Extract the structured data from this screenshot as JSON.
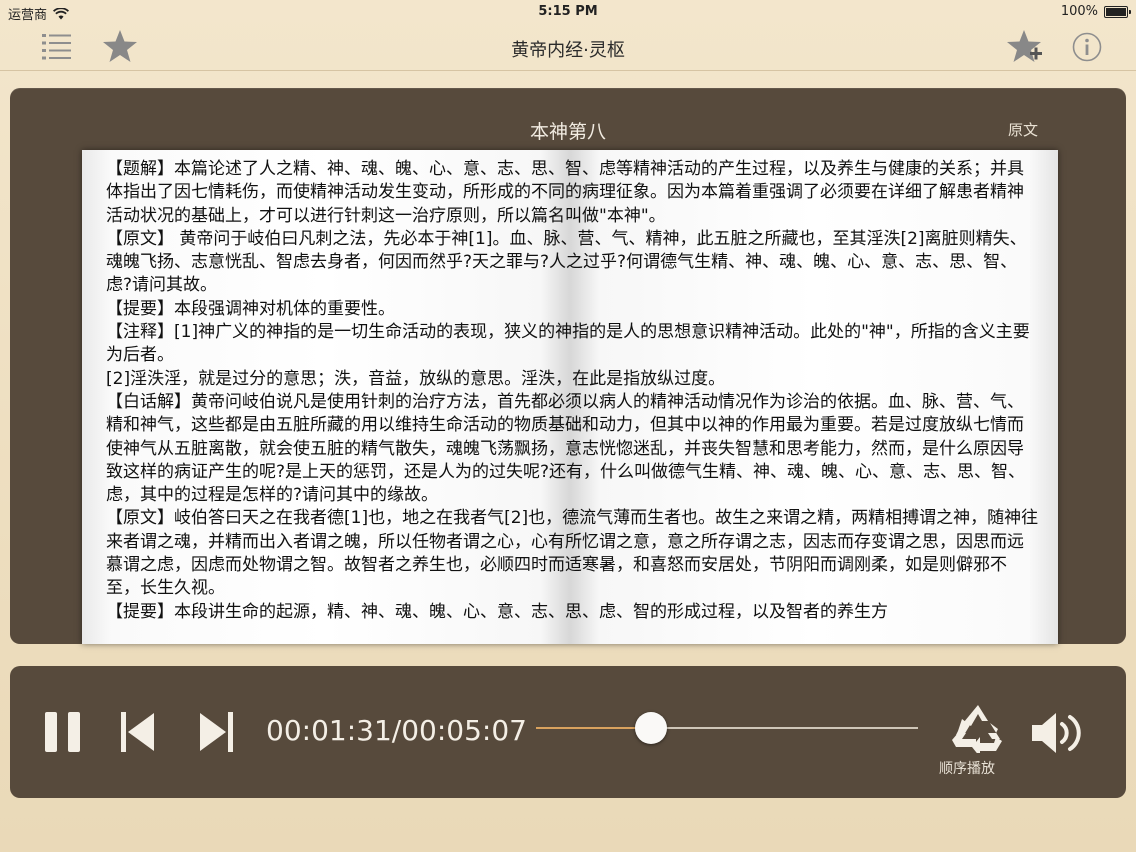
{
  "status_bar": {
    "carrier": "运营商",
    "time": "5:15 PM",
    "battery": "100%"
  },
  "nav": {
    "title": "黄帝内经·灵枢",
    "icons": [
      "list-icon",
      "star-icon",
      "star-add-icon",
      "info-icon"
    ]
  },
  "chapter": {
    "title": "本神第八",
    "original_button": "原文",
    "paragraphs": [
      "【题解】本篇论述了人之精、神、魂、魄、心、意、志、思、智、虑等精神活动的产生过程，以及养生与健康的关系；并具体指出了因七情耗伤，而使精神活动发生变动，所形成的不同的病理征象。因为本篇着重强调了必须要在详细了解患者精神活动状况的基础上，才可以进行针刺这一治疗原则，所以篇名叫做\"本神\"。",
      "【原文】 黄帝问于岐伯曰凡刺之法，先必本于神[1]。血、脉、营、气、精神，此五脏之所藏也，至其淫泆[2]离脏则精失、魂魄飞扬、志意恍乱、智虑去身者，何因而然乎?天之罪与?人之过乎?何谓德气生精、神、魂、魄、心、意、志、思、智、虑?请问其故。",
      "【提要】本段强调神对机体的重要性。",
      "【注释】[1]神广义的神指的是一切生命活动的表现，狭义的神指的是人的思想意识精神活动。此处的\"神\"，所指的含义主要为后者。",
      "[2]淫泆淫，就是过分的意思；泆，音益，放纵的意思。淫泆，在此是指放纵过度。",
      "【白话解】黄帝问岐伯说凡是使用针刺的治疗方法，首先都必须以病人的精神活动情况作为诊治的依据。血、脉、营、气、精和神气，这些都是由五脏所藏的用以维持生命活动的物质基础和动力，但其中以神的作用最为重要。若是过度放纵七情而使神气从五脏离散，就会使五脏的精气散失，魂魄飞荡飘扬，意志恍惚迷乱，并丧失智慧和思考能力，然而，是什么原因导致这样的病证产生的呢?是上天的惩罚，还是人为的过失呢?还有，什么叫做德气生精、神、魂、魄、心、意、志、思、智、虑，其中的过程是怎样的?请问其中的缘故。",
      "【原文】岐伯答曰天之在我者德[1]也，地之在我者气[2]也，德流气薄而生者也。故生之来谓之精，两精相搏谓之神，随神往来者谓之魂，并精而出入者谓之魄，所以任物者谓之心，心有所忆谓之意，意之所存谓之志，因志而存变谓之思，因思而远慕谓之虑，因虑而处物谓之智。故智者之养生也，必顺四时而适寒暑，和喜怒而安居处，节阴阳而调刚柔，如是则僻邪不至，长生久视。",
      "【提要】本段讲生命的起源，精、神、魂、魄、心、意、志、思、虑、智的形成过程，以及智者的养生方"
    ]
  },
  "player": {
    "time_display": "00:01:31/00:05:07",
    "progress_fraction": 0.3,
    "play_mode_label": "顺序播放",
    "icons": [
      "pause-icon",
      "previous-icon",
      "next-icon",
      "recycle-icon",
      "volume-icon"
    ]
  }
}
